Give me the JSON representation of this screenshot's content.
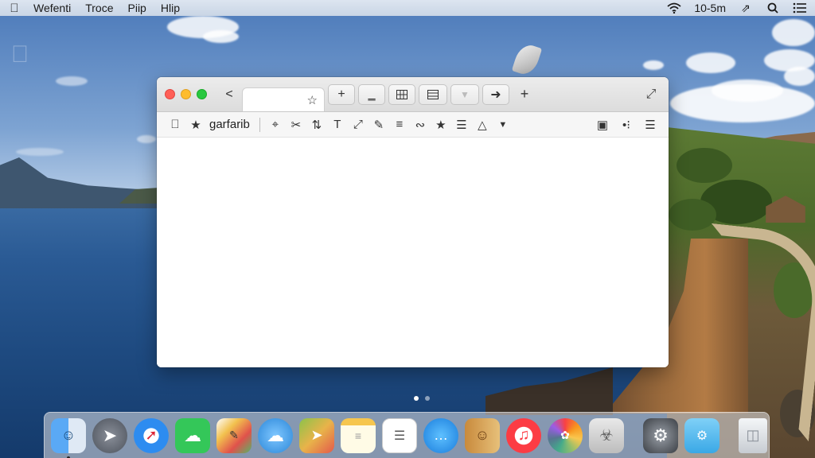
{
  "menubar": {
    "apple_glyph": "",
    "items": [
      "Wefenti",
      "Troce",
      "Piip",
      "Hlip"
    ],
    "clock": "10-5m"
  },
  "window": {
    "title_tab_icon": "☆",
    "back_glyph": "<",
    "toolbar_label": "garfarib"
  },
  "dock": {
    "apps": [
      "finder-icon",
      "launchpad-icon",
      "safari-icon",
      "messages-icon",
      "sketch-icon",
      "weather-icon",
      "maps-icon",
      "notes-icon",
      "textedit-icon",
      "chat-icon",
      "contacts-icon",
      "music-icon",
      "photos-icon",
      "app-icon",
      "system-preferences-icon",
      "folder-icon",
      "trash-icon"
    ]
  },
  "colors": {
    "accent": "#1a73e8",
    "traffic_red": "#ff5f57",
    "traffic_yellow": "#febc2e",
    "traffic_green": "#28c840"
  }
}
